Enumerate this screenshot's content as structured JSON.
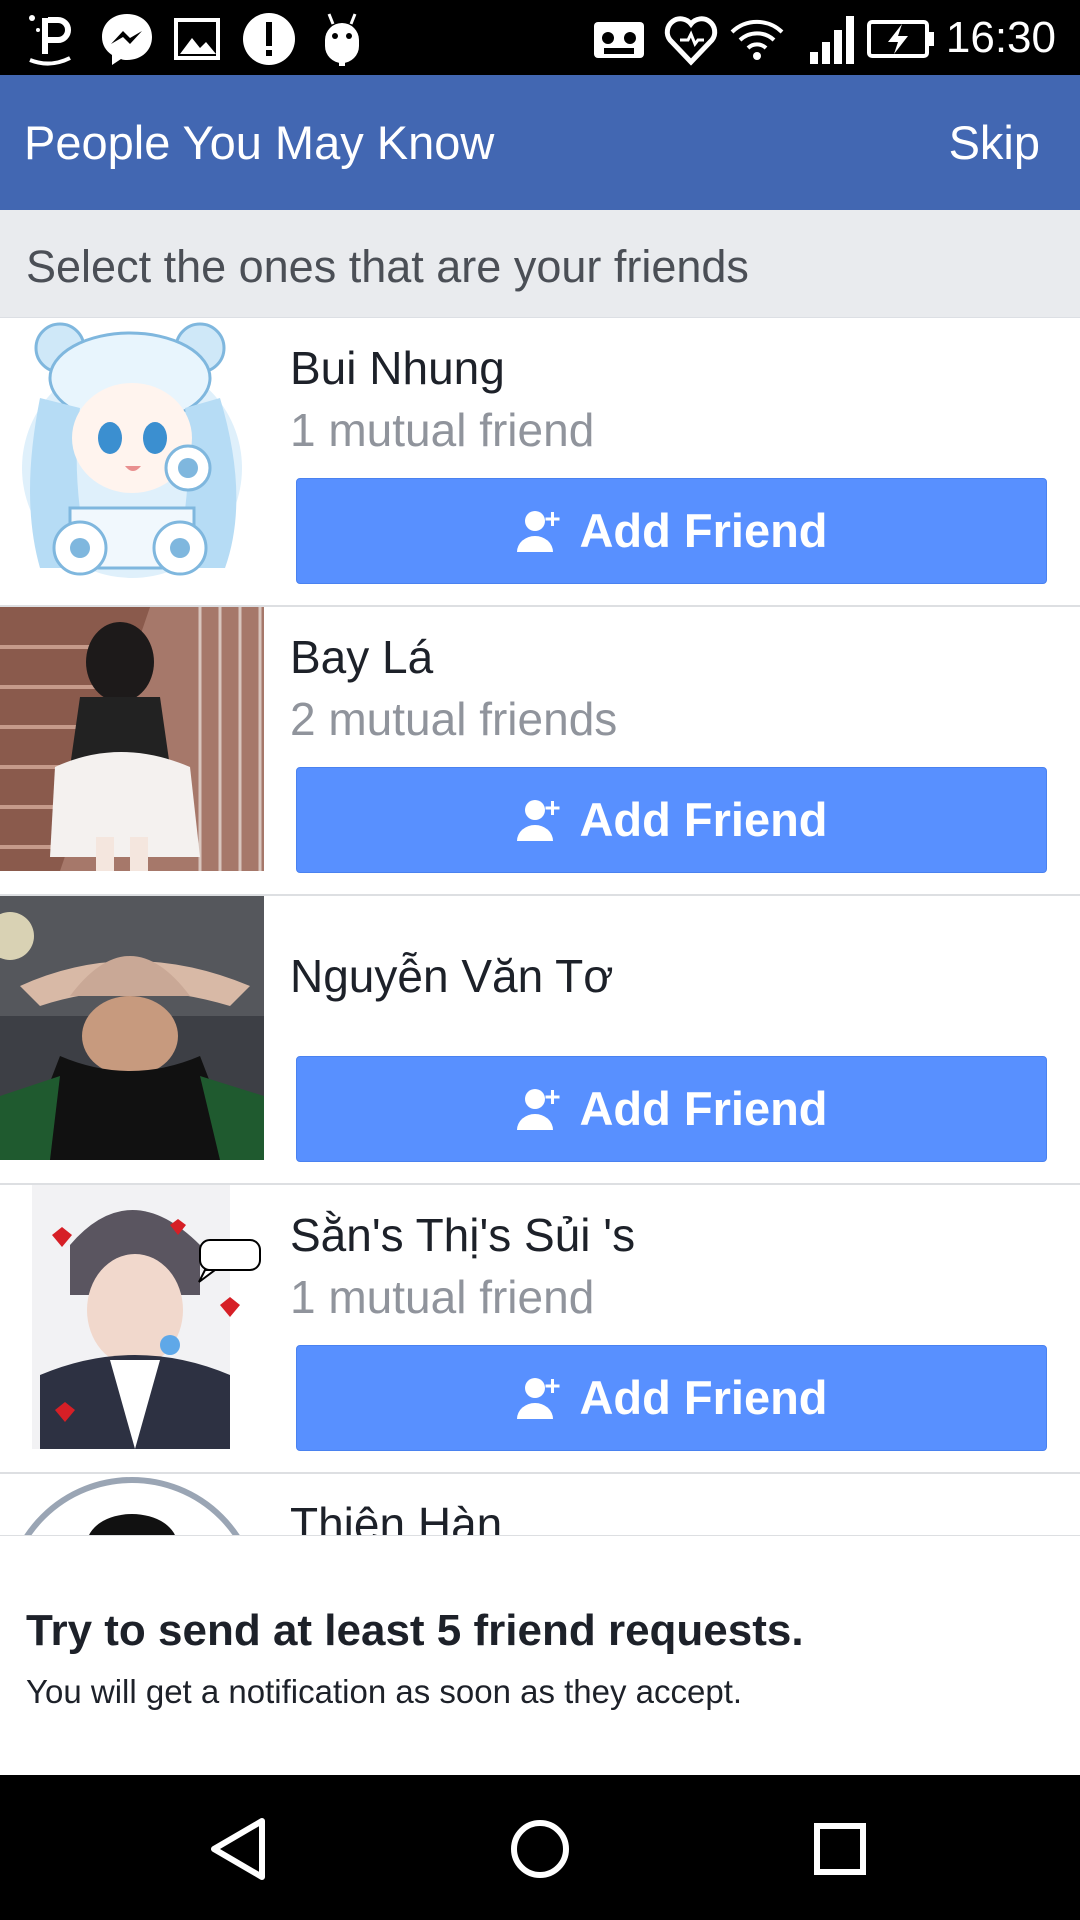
{
  "status_bar": {
    "time": "16:30",
    "left_icons": [
      "app-icon",
      "messenger-icon",
      "image-icon",
      "alert-icon",
      "android-icon"
    ],
    "right_icons": [
      "voicemail-icon",
      "heart-icon",
      "wifi-icon",
      "signal-icon",
      "battery-charging-icon"
    ]
  },
  "header": {
    "title": "People You May Know",
    "skip_label": "Skip",
    "background": "#4267b2"
  },
  "subheader": {
    "text": "Select the ones that are your friends"
  },
  "people": [
    {
      "name": "Bui Nhung",
      "mutual": "1 mutual friend",
      "button_label": "Add Friend"
    },
    {
      "name": "Bay Lá",
      "mutual": "2 mutual friends",
      "button_label": "Add Friend"
    },
    {
      "name": "Nguyễn Văn Tơ",
      "mutual": "",
      "button_label": "Add Friend"
    },
    {
      "name": "Sằn's Thị's Sủi 's",
      "mutual": "1 mutual friend",
      "button_label": "Add Friend"
    },
    {
      "name": "Thiên Hàn",
      "mutual": "",
      "button_label": ""
    }
  ],
  "footer": {
    "headline": "Try to send at least 5 friend requests.",
    "subtext": "You will get a notification as soon as they accept."
  },
  "nav": {
    "buttons": [
      "back-icon",
      "home-icon",
      "recents-icon"
    ]
  },
  "colors": {
    "brand": "#4267b2",
    "button": "#5890ff",
    "muted_text": "#90949c"
  }
}
